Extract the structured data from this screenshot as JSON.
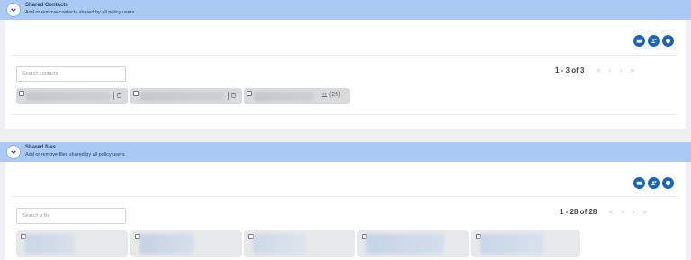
{
  "contacts_section": {
    "title": "Shared Contacts",
    "subtitle": "Add or remove contacts shared by all policy users",
    "actions": [
      "contact-card-icon",
      "add-user-icon",
      "shield-icon"
    ],
    "search_placeholder": "Search contacts",
    "pagination": {
      "text": "1 - 3 of 3",
      "first": "«",
      "prev": "‹",
      "next": "›",
      "last": "»"
    },
    "chips": [
      {
        "trailing_icon": "trash-icon",
        "count": ""
      },
      {
        "trailing_icon": "trash-icon",
        "count": ""
      },
      {
        "trailing_icon": "group-icon",
        "count": "(25)"
      }
    ]
  },
  "files_section": {
    "title": "Shared files",
    "subtitle": "Add or remove files shared by all policy users",
    "actions": [
      "contact-card-icon",
      "add-user-icon",
      "shield-icon"
    ],
    "search_placeholder": "Search a file",
    "pagination": {
      "text": "1 - 28 of 28",
      "first": "«",
      "prev": "‹",
      "next": "›",
      "last": "»"
    }
  },
  "colors": {
    "header_bg": "#aac9f5",
    "accent": "#1565c0",
    "chip_bg": "#d9dadb",
    "file_chip_bg": "#e6e8ea"
  }
}
